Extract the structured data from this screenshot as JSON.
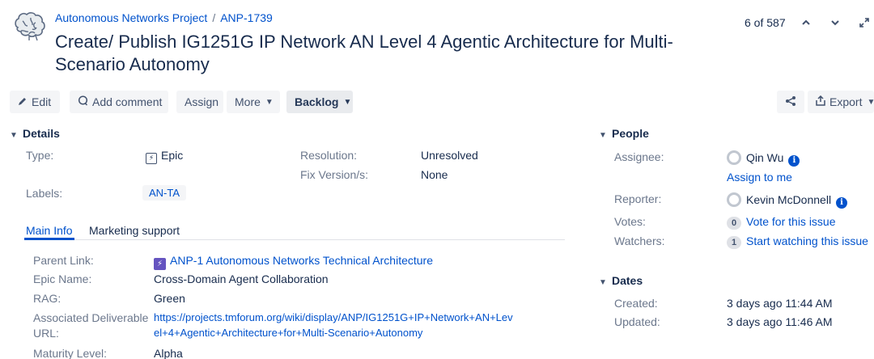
{
  "header": {
    "project": "Autonomous Networks Project",
    "separator": "/",
    "issue_key": "ANP-1739",
    "title": "Create/ Publish IG1251G IP Network AN Level 4 Agentic Architecture for Multi-Scenario Autonomy",
    "pager": "6 of 587"
  },
  "toolbar": {
    "edit": "Edit",
    "add_comment": "Add comment",
    "assign": "Assign",
    "more": "More",
    "backlog": "Backlog",
    "export": "Export"
  },
  "details": {
    "heading": "Details",
    "type_label": "Type:",
    "type_value": "Epic",
    "resolution_label": "Resolution:",
    "resolution_value": "Unresolved",
    "fix_label": "Fix Version/s:",
    "fix_value": "None",
    "labels_label": "Labels:",
    "labels_value": "AN-TA"
  },
  "tabs": [
    "Main Info",
    "Marketing support"
  ],
  "main_info": {
    "parent_label": "Parent Link:",
    "parent_value": "ANP-1 Autonomous Networks Technical Architecture",
    "epic_name_label": "Epic Name:",
    "epic_name_value": "Cross-Domain Agent Collaboration",
    "rag_label": "RAG:",
    "rag_value": "Green",
    "deliverable_label_1": "Associated Deliverable",
    "deliverable_label_2": "URL:",
    "deliverable_value_1": "https://projects.tmforum.org/wiki/display/ANP/IG1251G+IP+Network+AN+Lev",
    "deliverable_value_2": "el+4+Agentic+Architecture+for+Multi-Scenario+Autonomy",
    "maturity_label": "Maturity Level:",
    "maturity_value": "Alpha"
  },
  "people": {
    "heading": "People",
    "assignee_label": "Assignee:",
    "assignee_value": "Qin Wu",
    "assign_to_me": "Assign to me",
    "reporter_label": "Reporter:",
    "reporter_value": "Kevin McDonnell",
    "votes_label": "Votes:",
    "votes_count": "0",
    "votes_link": "Vote for this issue",
    "watchers_label": "Watchers:",
    "watchers_count": "1",
    "watchers_link": "Start watching this issue"
  },
  "dates": {
    "heading": "Dates",
    "created_label": "Created:",
    "created_value": "3 days ago 11:44 AM",
    "updated_label": "Updated:",
    "updated_value": "3 days ago 11:46 AM"
  },
  "colors": {
    "link": "#0052cc",
    "text": "#172b4d",
    "label": "#6b778c",
    "epic": "#6554c0"
  },
  "icons": [
    "brain-logo-icon",
    "chevron-up-icon",
    "chevron-down-icon",
    "expand-icon",
    "pencil-icon",
    "comment-icon",
    "share-icon",
    "export-icon",
    "epic-icon",
    "info-icon",
    "avatar"
  ]
}
